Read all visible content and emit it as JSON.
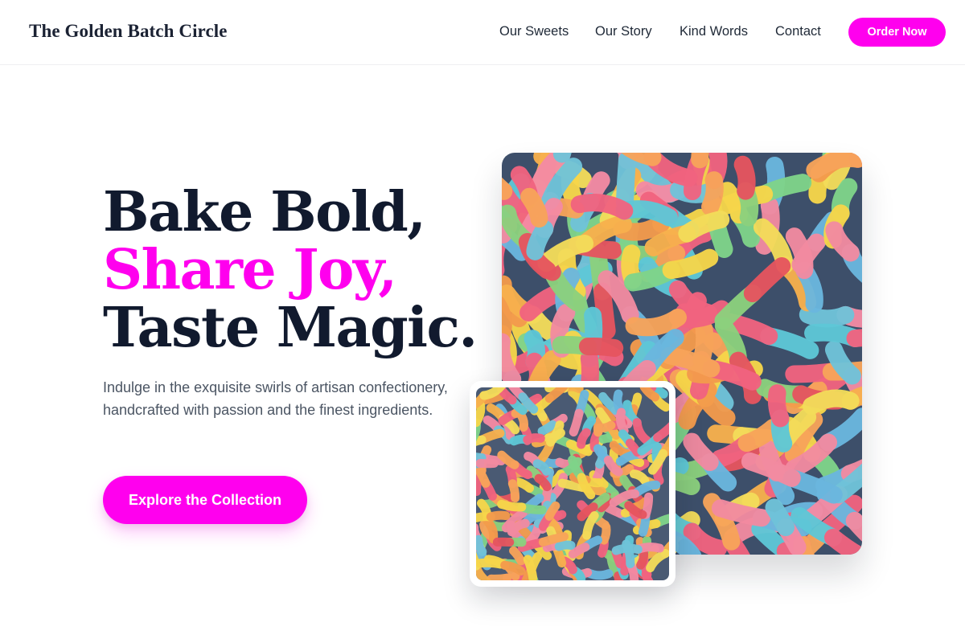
{
  "header": {
    "brand": "The Golden Batch Circle",
    "nav": [
      "Our Sweets",
      "Our Story",
      "Kind Words",
      "Contact"
    ],
    "order_label": "Order Now"
  },
  "hero": {
    "title_line1": "Bake Bold,",
    "title_line2": "Share Joy,",
    "title_line3": "Taste Magic.",
    "description": "Indulge in the exquisite swirls of artisan confectionery, handcrafted with passion and the finest ingredients.",
    "cta_label": "Explore the Collection"
  },
  "images": {
    "main": "sour-gummy-worms-photo",
    "thumbnail": "sour-gummy-worms-closeup-photo"
  },
  "colors": {
    "accent": "#ff00ee",
    "heading": "#111a2e",
    "body_text": "#4b5563"
  }
}
